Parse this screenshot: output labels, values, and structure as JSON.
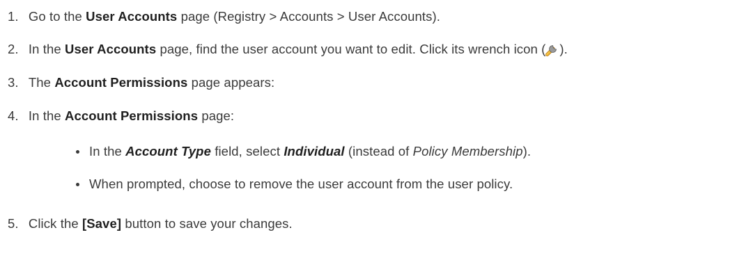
{
  "steps": [
    {
      "number": "1.",
      "parts": [
        "Go to the ",
        "User Accounts",
        " page (Registry > Accounts > User Accounts)."
      ]
    },
    {
      "number": "2.",
      "parts": [
        "In the ",
        "User Accounts",
        " page, find the user account you want to edit. Click its wrench icon (",
        ")."
      ]
    },
    {
      "number": "3.",
      "parts": [
        "The ",
        "Account Permissions",
        " page appears:"
      ]
    },
    {
      "number": "4.",
      "parts": [
        "In the ",
        "Account Permissions",
        " page:"
      ]
    },
    {
      "number": "5.",
      "parts": [
        "Click the ",
        "[Save]",
        " button to save your changes."
      ]
    }
  ],
  "substeps": [
    {
      "parts": [
        "In the ",
        "Account Type",
        " field, select ",
        "Individual",
        " (instead of ",
        "Policy Membership",
        ")."
      ]
    },
    {
      "parts": [
        "When prompted, choose to remove the user account from the user policy."
      ]
    }
  ],
  "icons": {
    "wrench": "wrench-icon"
  },
  "colors": {
    "text": "#3a3a3a",
    "bold_text": "#1f1f1f",
    "wrench_handle": "#f2b81c",
    "wrench_head": "#7a7a7a"
  }
}
